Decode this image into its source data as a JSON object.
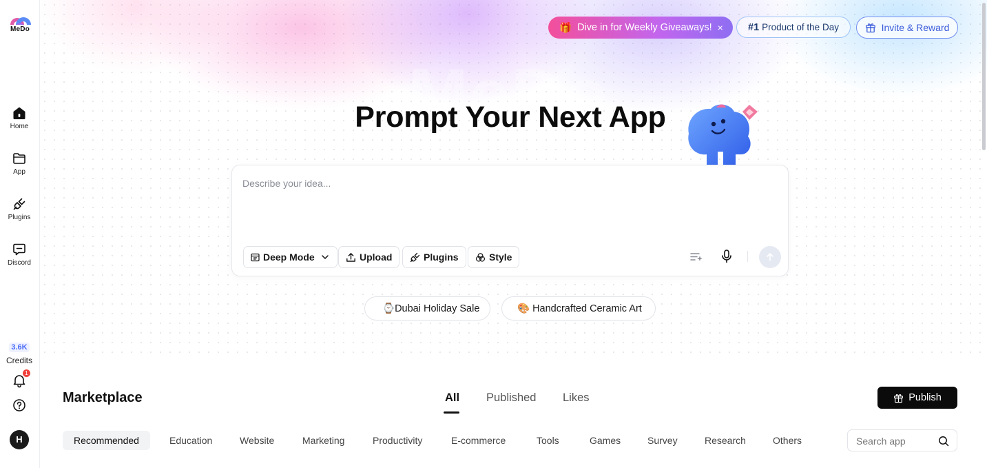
{
  "brand": {
    "name": "MeDo",
    "logo_icon": "medo-logo-icon"
  },
  "sidebar": {
    "items": [
      {
        "label": "Home",
        "icon": "home-icon"
      },
      {
        "label": "App",
        "icon": "folder-icon"
      },
      {
        "label": "Plugins",
        "icon": "plug-icon"
      },
      {
        "label": "Discord",
        "icon": "chat-icon"
      }
    ],
    "credits": {
      "value": "3.6K",
      "label": "Credits"
    },
    "notifications": {
      "count": "1",
      "icon": "bell-icon"
    },
    "help_icon": "help-icon",
    "avatar_initial": "H"
  },
  "banner": {
    "promo": {
      "emoji": "🎁",
      "text": "Dive in for Weekly Giveaways!",
      "close": "×"
    },
    "product": {
      "rank": "#1",
      "text": "Product of the Day"
    },
    "invite": {
      "text": "Invite & Reward",
      "icon": "gift-icon"
    }
  },
  "hero": {
    "watermark": "MeDo",
    "headline": "Prompt Your Next App",
    "mascot": "mascot-illustration"
  },
  "prompt": {
    "placeholder": "Describe your idea...",
    "buttons": {
      "deep_mode": "Deep Mode",
      "upload": "Upload",
      "plugins": "Plugins",
      "style": "Style"
    },
    "right_tools": [
      "prompt-enhance-icon",
      "microphone-icon",
      "send-arrow-icon"
    ]
  },
  "suggestions": [
    {
      "emoji": "⌚",
      "text": "Dubai Holiday Sale"
    },
    {
      "emoji": "🎨",
      "text": "Handcrafted Ceramic Art"
    }
  ],
  "marketplace": {
    "title": "Marketplace",
    "tabs": [
      "All",
      "Published",
      "Likes"
    ],
    "active_tab": "All",
    "publish_label": "Publish",
    "categories": [
      "Recommended",
      "Education",
      "Website",
      "Marketing",
      "Productivity",
      "E-commerce",
      "Tools",
      "Games",
      "Survey",
      "Research",
      "Others"
    ],
    "active_category": "Recommended",
    "search_placeholder": "Search app"
  },
  "colors": {
    "accent_blue": "#3b5bdb",
    "promo_pink": "#f34f9b",
    "promo_purple": "#8e6ef2",
    "badge_red": "#f0413c"
  }
}
